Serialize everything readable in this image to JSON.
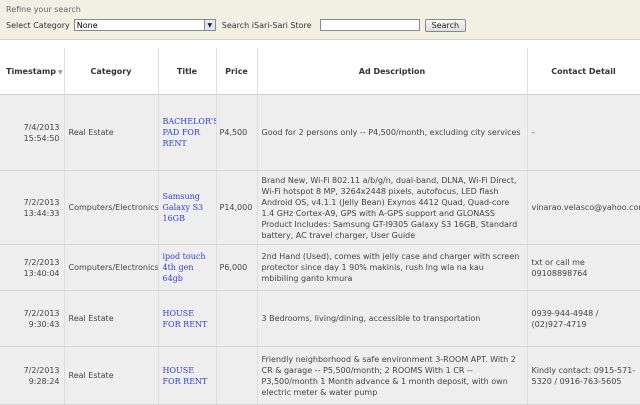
{
  "refine": {
    "title": "Refine your search",
    "category_label": "Select Category",
    "category_value": "None",
    "store_label": "Search iSari-Sari Store",
    "search_value": "",
    "search_button": "Search"
  },
  "table": {
    "columns": [
      "Timestamp",
      "Category",
      "Title",
      "Price",
      "Ad Description",
      "Contact Detail"
    ],
    "rows": [
      {
        "date": "7/4/2013",
        "time": "15:54:50",
        "category": "Real Estate",
        "title": "BACHELOR'S PAD FOR RENT",
        "price": "P4,500",
        "description": "Good for 2 persons only -- P4,500/month, excluding city services",
        "contact": "-"
      },
      {
        "date": "7/2/2013",
        "time": "13:44:33",
        "category": "Computers/Electronics",
        "title": "Samsung Galaxy S3 16GB",
        "price": "P14,000",
        "description": "Brand New, Wi-Fi 802.11 a/b/g/n, dual-band, DLNA, Wi-Fi Direct, Wi-Fi hotspot 8 MP, 3264x2448 pixels, autofocus, LED flash Android OS, v4.1.1 (Jelly Bean) Exynos 4412 Quad, Quad-core 1.4 GHz Cortex-A9, GPS with A-GPS support and GLONASS Product Includes: Samsung GT-I9305 Galaxy S3 16GB, Standard battery, AC travel charger, User Guide",
        "contact": "vinarao.velasco@yahoo.com"
      },
      {
        "date": "7/2/2013",
        "time": "13:40:04",
        "category": "Computers/Electronics",
        "title": "ipod touch 4th gen 64gb",
        "price": "P6,000",
        "description": "2nd Hand (Used), comes with jelly case and charger with screen protector since day 1 90% makinis, rush lng wla na kau mbibiling ganto kmura",
        "contact": "txt or call me 09108898764"
      },
      {
        "date": "7/2/2013",
        "time": "9:30:43",
        "category": "Real Estate",
        "title": "HOUSE FOR RENT",
        "price": "",
        "description": "3 Bedrooms, living/dining, accessible to transportation",
        "contact": "0939-944-4948 / (02)927-4719"
      },
      {
        "date": "7/2/2013",
        "time": "9:28:24",
        "category": "Real Estate",
        "title": "HOUSE FOR RENT",
        "price": "",
        "description": "Friendly neighborhood & safe environment 3-ROOM APT. With 2 CR & garage -- P5,500/month; 2 ROOMS With 1 CR -- P3,500/month 1 Month advance & 1 month deposit, with own electric meter & water pump",
        "contact": "Kindly contact: 0915-571-5320 / 0916-763-5605"
      }
    ]
  }
}
